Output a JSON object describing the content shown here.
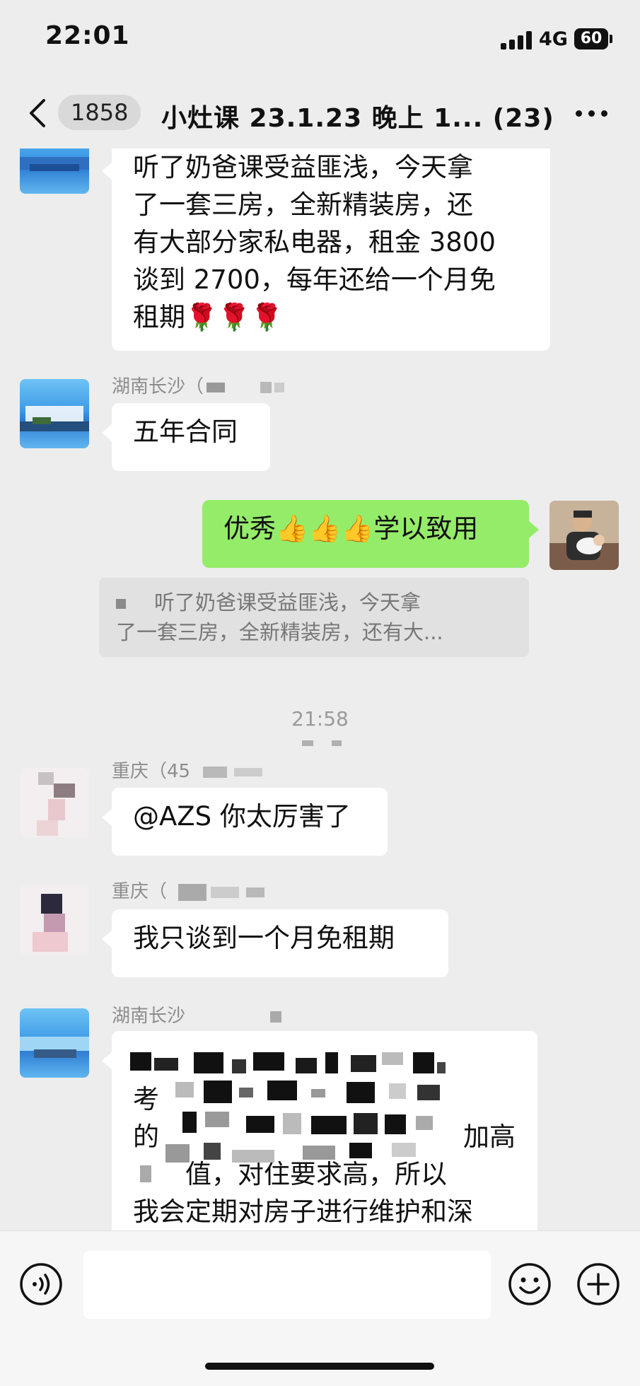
{
  "status": {
    "time": "22:01",
    "network": "4G",
    "battery": "60"
  },
  "nav": {
    "unread_count": "1858",
    "title": "小灶课 23.1.23 晚上 1... (23)"
  },
  "messages": {
    "m1": {
      "lines": [
        "听了奶爸课受益匪浅，今天拿",
        "了一套三房，全新精装房，还",
        "有大部分家私电器，租金 3800",
        "谈到 2700，每年还给一个月免",
        "租期🌹🌹🌹"
      ]
    },
    "m2": {
      "sender": "湖南长沙（",
      "text": "五年合同"
    },
    "m3": {
      "text": "优秀👍👍👍学以致用"
    },
    "quote": {
      "lines": [
        "听了奶爸课受益匪浅，今天拿",
        "了一套三房，全新精装房，还有大..."
      ]
    },
    "time_stamp": "21:58",
    "m4": {
      "sender": "重庆（45",
      "text": "@AZS 你太厉害了"
    },
    "m5": {
      "sender": "重庆（",
      "text": "我只谈到一个月免租期"
    },
    "m6": {
      "sender": "湖南长沙",
      "line_a": "考",
      "line_b": "的",
      "line_b_end": "加高",
      "line_c": "值，对住要求高，所以",
      "line_d": "我会定期对房子进行维护和深"
    }
  },
  "colors": {
    "background": "#ededed",
    "my_bubble": "#95ec69",
    "other_bubble": "#ffffff"
  }
}
